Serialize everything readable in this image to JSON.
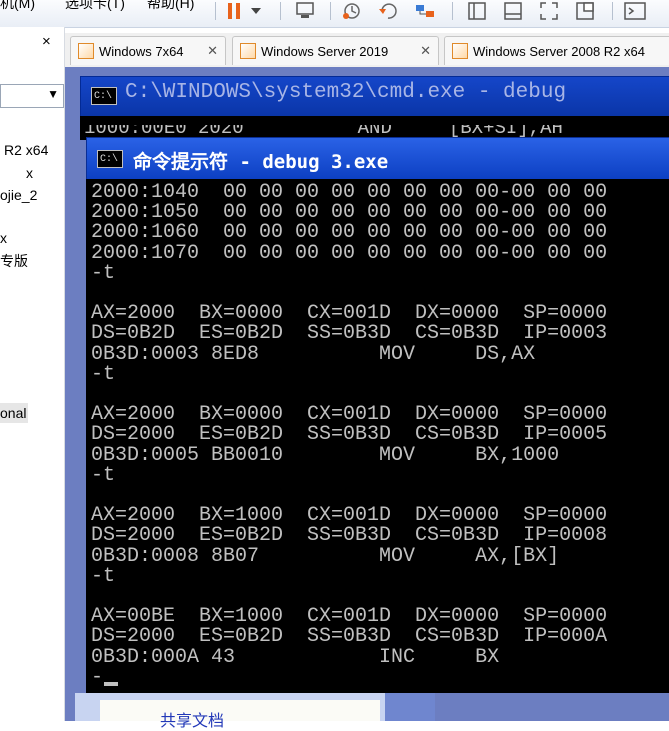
{
  "menubar": {
    "items": [
      "机(M)",
      "选项卡(T)",
      "帮助(H)"
    ]
  },
  "toolbar": {
    "icons": [
      "pause-icon",
      "dropdown-icon",
      "send-keys-icon",
      "snapshot-icon",
      "revert-snapshot-icon",
      "snapshot-manager-icon",
      "normal-view-icon",
      "console-view-icon",
      "fullscreen-icon",
      "unity-icon",
      "terminal-icon"
    ]
  },
  "left_panel": {
    "close": "×",
    "items": [
      "R2 x64",
      "x",
      "ojie_2",
      "x",
      "专版",
      "onal"
    ]
  },
  "tabs": [
    {
      "label": "Windows 7x64"
    },
    {
      "label": "Windows Server 2019"
    },
    {
      "label": "Windows Server 2008 R2 x64"
    }
  ],
  "back_window": {
    "title": "C:\\WINDOWS\\system32\\cmd.exe - debug",
    "partial_line": "1000:00E0 2020          AND     [BX+SI],AH"
  },
  "front_window": {
    "title": "命令提示符 - debug 3.exe",
    "lines": [
      "2000:1040  00 00 00 00 00 00 00 00-00 00 00",
      "2000:1050  00 00 00 00 00 00 00 00-00 00 00",
      "2000:1060  00 00 00 00 00 00 00 00-00 00 00",
      "2000:1070  00 00 00 00 00 00 00 00-00 00 00",
      "-t",
      "",
      "AX=2000  BX=0000  CX=001D  DX=0000  SP=0000",
      "DS=0B2D  ES=0B2D  SS=0B3D  CS=0B3D  IP=0003",
      "0B3D:0003 8ED8          MOV     DS,AX",
      "-t",
      "",
      "AX=2000  BX=0000  CX=001D  DX=0000  SP=0000",
      "DS=2000  ES=0B2D  SS=0B3D  CS=0B3D  IP=0005",
      "0B3D:0005 BB0010        MOV     BX,1000",
      "-t",
      "",
      "AX=2000  BX=1000  CX=001D  DX=0000  SP=0000",
      "DS=2000  ES=0B2D  SS=0B3D  CS=0B3D  IP=0008",
      "0B3D:0008 8B07          MOV     AX,[BX]",
      "-t",
      "",
      "AX=00BE  BX=1000  CX=001D  DX=0000  SP=0000",
      "DS=2000  ES=0B2D  SS=0B3D  CS=0B3D  IP=000A",
      "0B3D:000A 43            INC     BX",
      "-"
    ]
  },
  "vm_bottom": {
    "partial_text": "共享文档"
  }
}
